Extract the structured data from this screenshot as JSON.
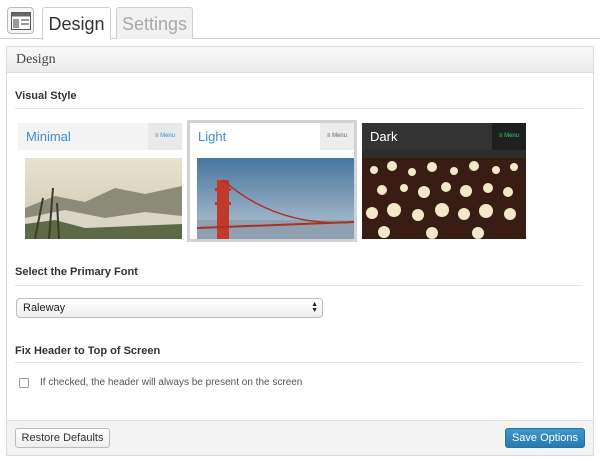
{
  "tabs": [
    {
      "label": "Design",
      "active": true
    },
    {
      "label": "Settings",
      "active": false
    }
  ],
  "panel": {
    "title": "Design",
    "visual_style": {
      "heading": "Visual Style",
      "options": [
        {
          "name": "Minimal",
          "menu_label": "Menu",
          "selected": false
        },
        {
          "name": "Light",
          "menu_label": "Menu",
          "selected": true
        },
        {
          "name": "Dark",
          "menu_label": "Menu",
          "selected": false
        }
      ]
    },
    "font": {
      "heading": "Select the Primary Font",
      "selected": "Raleway"
    },
    "fix_header": {
      "heading": "Fix Header to Top of Screen",
      "checked": false,
      "label": "If checked, the header will always be present on the screen"
    },
    "footer": {
      "restore_label": "Restore Defaults",
      "save_label": "Save Options"
    }
  },
  "colors": {
    "accent": "#2a78b0",
    "minimal_name": "#3b8fd1",
    "light_name": "#3b8fd1",
    "dark_menu": "#2ecc71"
  }
}
